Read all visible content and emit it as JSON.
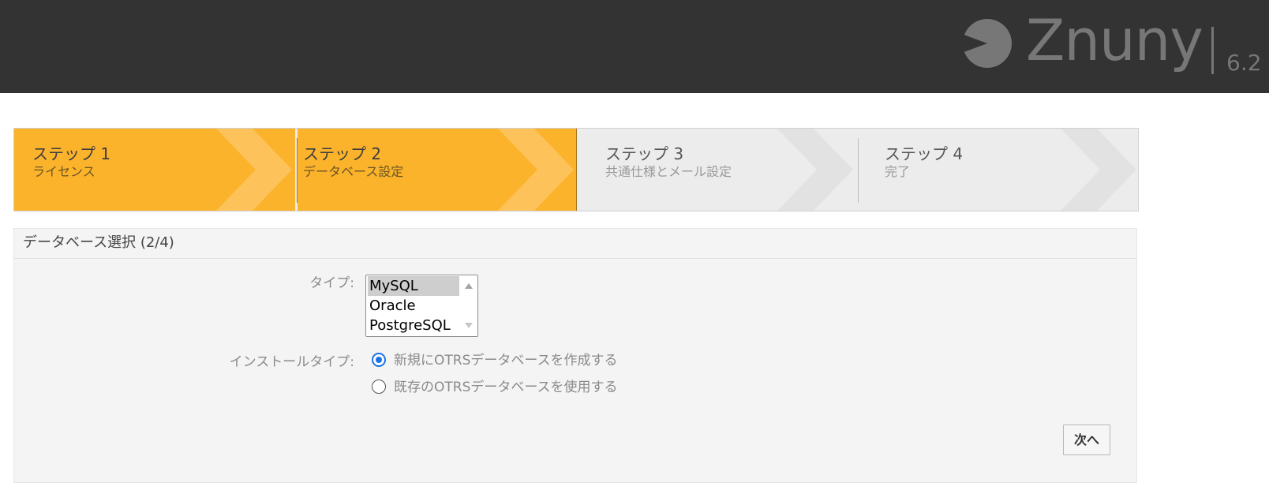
{
  "header": {
    "brand": "Znuny",
    "version": "6.2",
    "colors": {
      "background": "#333333",
      "logo": "#777777"
    }
  },
  "steps": [
    {
      "title": "ステップ 1",
      "subtitle": "ライセンス",
      "state": "completed"
    },
    {
      "title": "ステップ 2",
      "subtitle": "データベース設定",
      "state": "completed"
    },
    {
      "title": "ステップ 3",
      "subtitle": "共通仕様とメール設定",
      "state": "pending"
    },
    {
      "title": "ステップ 4",
      "subtitle": "完了",
      "state": "pending"
    }
  ],
  "step_colors": {
    "completed": "#fcb32c",
    "pending": "#ececec"
  },
  "panel": {
    "title": "データベース選択 (2/4)",
    "type_label": "タイプ:",
    "type_options": [
      "MySQL",
      "Oracle",
      "PostgreSQL"
    ],
    "type_selected": "MySQL",
    "install_type_label": "インストールタイプ:",
    "install_options": [
      {
        "label": "新規にOTRSデータベースを作成する",
        "checked": true
      },
      {
        "label": "既存のOTRSデータベースを使用する",
        "checked": false
      }
    ],
    "next_button": "次へ"
  }
}
